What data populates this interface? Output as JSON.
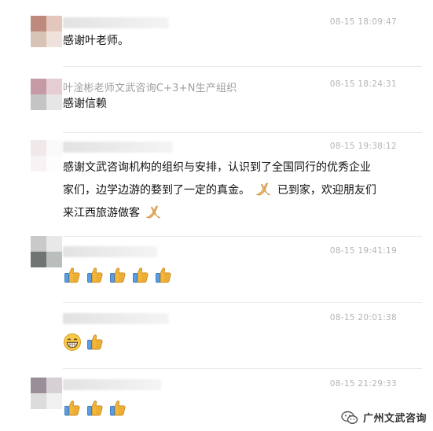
{
  "comments": [
    {
      "time": "08-15 18:09:47",
      "text": "感谢叶老师。",
      "avatar_colors": [
        "#bf8a7e",
        "#e3c7bd",
        "#d9c3b7",
        "#efe2dc"
      ]
    },
    {
      "nickname": "叶淦彬老师文武咨询C+3+N生产组织",
      "time": "08-15 18:24:31",
      "text": "感谢信赖",
      "avatar_colors": [
        "#c69aa4",
        "#e6cdd3",
        "#c4c4c4",
        "#e6e6e6"
      ]
    },
    {
      "time": "08-15 19:38:12",
      "text_line1": "感谢文武咨询机构的组织与安排，认识到了全国同行的优秀企业",
      "text_line2a": "家们，边学边游的婺到了一定的真金。",
      "text_line2b": "已到家，欢迎朋友们",
      "text_line3": "来江西旅游做客",
      "avatar_colors": [
        "#f1e8ea",
        "#fafafa",
        "#f7f2f3",
        "#fdfdfd"
      ]
    },
    {
      "time": "08-15 19:41:19",
      "emojis": [
        "thumbs-up-emoji",
        "thumbs-up-emoji",
        "thumbs-up-emoji",
        "thumbs-up-emoji",
        "thumbs-up-emoji"
      ],
      "avatar_colors": [
        "#c9c9c9",
        "#e8e8e8",
        "#6f7572",
        "#b9bdbb"
      ]
    },
    {
      "time": "08-15 20:01:38",
      "emojis": [
        "grin-emoji",
        "thumbs-up-emoji"
      ]
    },
    {
      "time": "08-15 21:29:33",
      "emojis": [
        "thumbs-up-emoji",
        "thumbs-up-emoji",
        "thumbs-up-emoji"
      ],
      "avatar_colors": [
        "#9a8f98",
        "#d6d0d4",
        "#dcdcdc",
        "#f0f0f0"
      ]
    }
  ],
  "watermark": {
    "icon": "wechat-icon",
    "text": "广州文武咨询"
  },
  "colors": {
    "time": "#b4b4b4",
    "nickname": "#a0a0a0",
    "text": "#111111",
    "divider": "#e9e9e9"
  }
}
